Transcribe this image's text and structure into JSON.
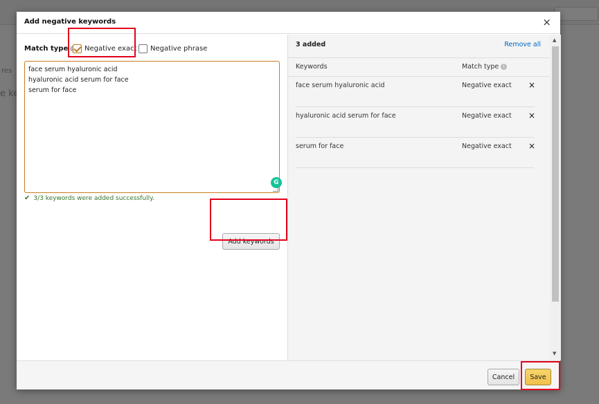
{
  "background": {
    "fragments": [
      "res",
      "e ke"
    ]
  },
  "dialog": {
    "title": "Add negative keywords",
    "close_glyph": "×"
  },
  "left": {
    "match_type_label": "Match type",
    "info_glyph": "i",
    "options": [
      {
        "label": "Negative exact",
        "checked": true
      },
      {
        "label": "Negative phrase",
        "checked": false
      }
    ],
    "keywords_lines": [
      "face serum hyaluronic acid",
      "hyaluronic acid serum for face",
      "serum for face"
    ],
    "grammarly_glyph": "G",
    "success_message": "3/3 keywords were added successfully.",
    "add_button_label": "Add keywords"
  },
  "right": {
    "count_label": "3 added",
    "remove_all_label": "Remove all",
    "columns": [
      "Keywords",
      "Match type"
    ],
    "rows": [
      {
        "keyword": "face serum hyaluronic acid",
        "match_type": "Negative exact"
      },
      {
        "keyword": "hyaluronic acid serum for face",
        "match_type": "Negative exact"
      },
      {
        "keyword": "serum for face",
        "match_type": "Negative exact"
      }
    ],
    "remove_glyph": "×"
  },
  "footer": {
    "cancel_label": "Cancel",
    "save_label": "Save"
  },
  "colors": {
    "accent_orange": "#c87c1d",
    "link_blue": "#0066c0",
    "success_green": "#36762b",
    "save_yellow": "#f0c14b",
    "highlight_red": "#e3001b"
  }
}
